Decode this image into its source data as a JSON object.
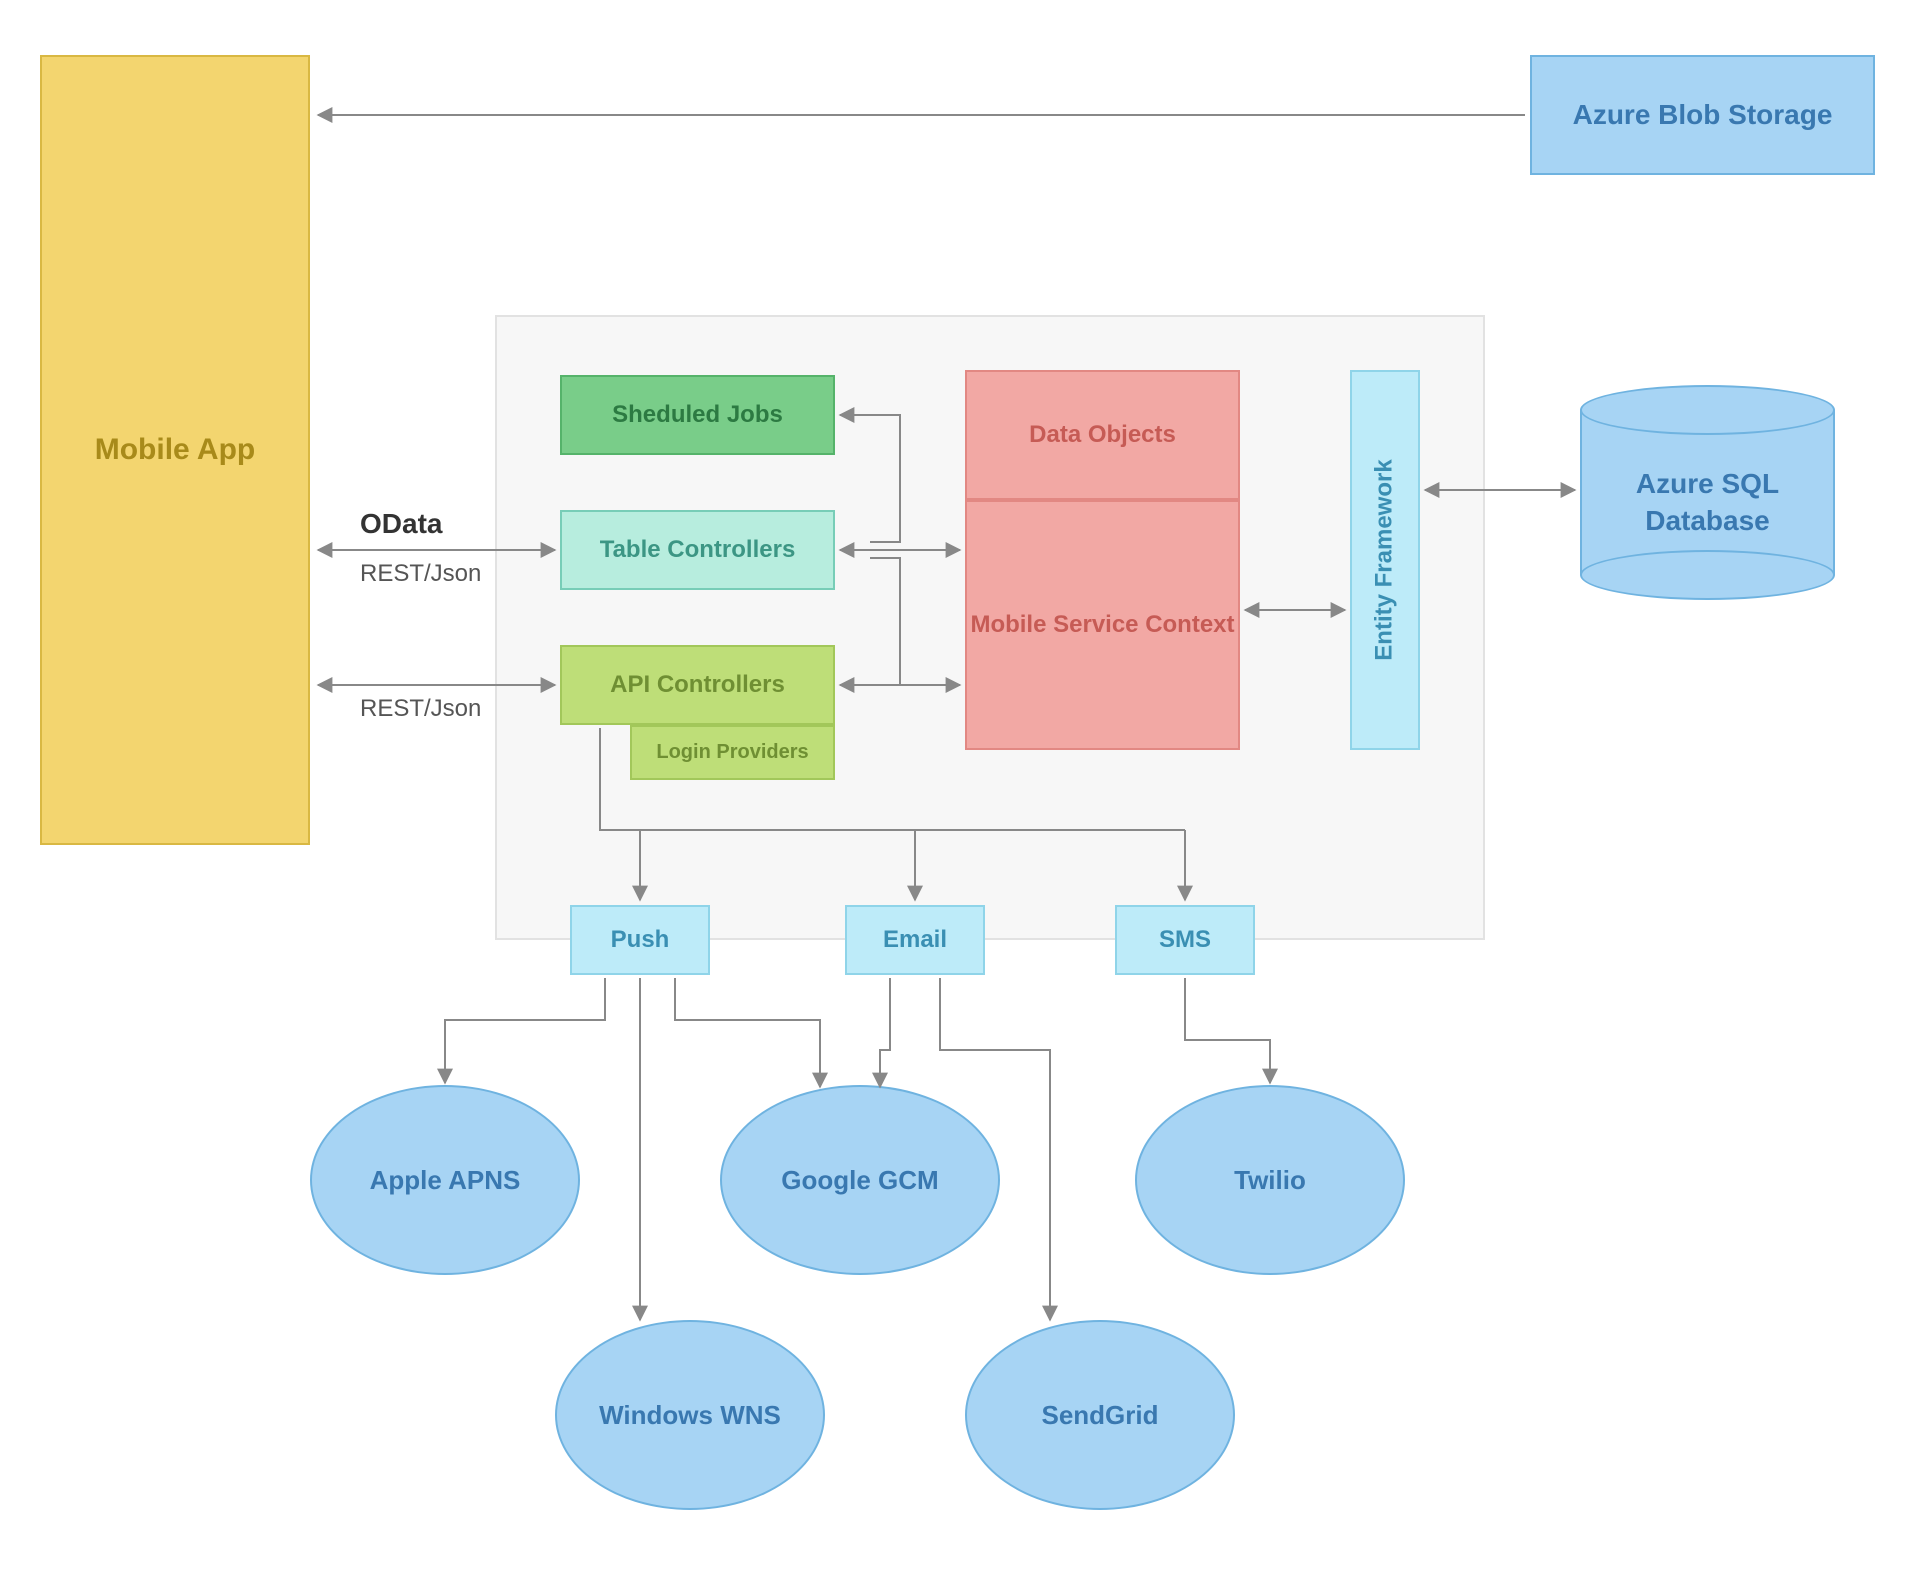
{
  "nodes": {
    "mobile_app": "Mobile App",
    "azure_blob": "Azure Blob Storage",
    "scheduled_jobs": "Sheduled Jobs",
    "table_controllers": "Table Controllers",
    "api_controllers": "API Controllers",
    "login_providers": "Login Providers",
    "data_objects": "Data Objects",
    "mobile_service_context": "Mobile Service Context",
    "entity_framework": "Entity Framework",
    "azure_sql": "Azure SQL Database",
    "push": "Push",
    "email": "Email",
    "sms": "SMS",
    "apple_apns": "Apple APNS",
    "windows_wns": "Windows WNS",
    "google_gcm": "Google GCM",
    "sendgrid": "SendGrid",
    "twilio": "Twilio"
  },
  "labels": {
    "odata": "OData",
    "rest_json_1": "REST/Json",
    "rest_json_2": "REST/Json"
  },
  "colors": {
    "mobile_fill": "#f3d56f",
    "mobile_stroke": "#d9b843",
    "mobile_text": "#a88a1a",
    "azure_fill": "#a7d4f4",
    "azure_stroke": "#6fb3e0",
    "azure_text": "#3978b0",
    "green_fill": "#79cd89",
    "green_stroke": "#55b36a",
    "green_text": "#2c7a42",
    "teal_fill": "#b7edde",
    "teal_stroke": "#77cdb7",
    "teal_text": "#3c9684",
    "lime_fill": "#bede78",
    "lime_stroke": "#a2c75a",
    "lime_text": "#6f8f33",
    "red_fill": "#f2a8a4",
    "red_stroke": "#e28883",
    "red_text": "#c65b55",
    "cyan_fill": "#bdebf9",
    "cyan_stroke": "#8fd4e9",
    "cyan_text": "#3a8fb3",
    "container_fill": "#f7f7f7",
    "container_stroke": "#e2e2e2",
    "arrow": "#888888"
  }
}
